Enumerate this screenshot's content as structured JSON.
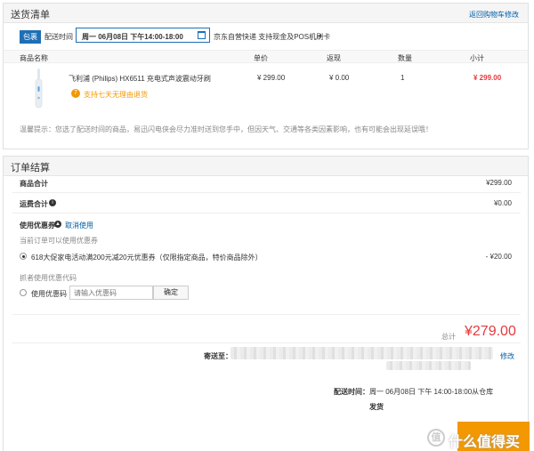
{
  "shipping": {
    "title": "送货清单",
    "back_link": "返回购物车修改",
    "badge": "包裹",
    "delivery_time_label": "配送时间",
    "delivery_time_value": "周一 06月08日 下午14:00-18:00",
    "delivery_note": "京东自营快递 支持现金及POS机刷卡",
    "plus": "+",
    "columns": [
      "商品名称",
      "单价",
      "返现",
      "数量",
      "小计"
    ],
    "item": {
      "name": "飞利浦 (Philips) HX6511 充电式声波震动牙刷",
      "price": "¥ 299.00",
      "cashback": "¥ 0.00",
      "qty": "1",
      "subtotal": "¥ 299.00",
      "return_badge": "7",
      "return_text": "支持七天无理由退货"
    },
    "tip": "温馨提示：您选了配送时间的商品，易迅闪电侠会尽力准时送到您手中，但因天气、交通等各类因素影响，也有可能会出现延误哦！"
  },
  "settlement": {
    "title": "订单结算",
    "goods_total_label": "商品合计",
    "goods_total_value": "¥299.00",
    "shipping_total_label": "运费合计",
    "shipping_total_value": "¥0.00",
    "coupon_label": "使用优惠券",
    "coupon_cancel": "取消使用",
    "coupon_hint": "当前订单可以使用优惠券",
    "coupon_option": "618大促家电活动满200元减20元优惠券（仅限指定商品，特价商品除外）",
    "coupon_value": "- ¥20.00",
    "code_hint": "抓者使用优惠代码",
    "code_label": "使用优惠码",
    "code_placeholder": "请输入优惠码",
    "confirm_button": "确定",
    "total_label": "总计",
    "total_value": "¥279.00",
    "ship_to_label": "寄送至：",
    "edit_link": "修改",
    "delivery_time_label": "配送时间：",
    "delivery_time_value": "周一 06月08日 下午 14:00-18:00从仓库",
    "dispatch": "发货",
    "watermark": "什么值得买"
  }
}
